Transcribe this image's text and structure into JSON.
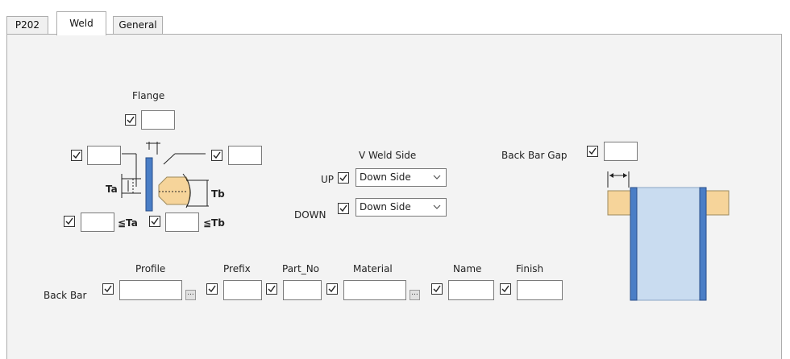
{
  "tabs": [
    "P202",
    "Weld",
    "General"
  ],
  "active_tab": "Weld",
  "flange": {
    "label": "Flange"
  },
  "diagram": {
    "ta": "Ta",
    "tb": "Tb",
    "le_ta": "≦Ta",
    "le_tb": "≦Tb"
  },
  "v_weld": {
    "title": "V Weld Side",
    "up_label": "UP",
    "down_label": "DOWN",
    "up_value": "Down Side",
    "down_value": "Down Side"
  },
  "back_bar_gap": {
    "label": "Back Bar Gap"
  },
  "back_bar": {
    "row_label": "Back Bar",
    "headers": {
      "profile": "Profile",
      "prefix": "Prefix",
      "part_no": "Part_No",
      "material": "Material",
      "name": "Name",
      "finish": "Finish"
    },
    "browse_button": "..."
  },
  "icons": {
    "checkbox_check": "check-icon",
    "dropdown": "chevron-down-icon"
  },
  "colors": {
    "plate_blue": "#4a7ec6",
    "bar_fill": "#c9dcf0",
    "weld_fill": "#f6d49a",
    "weld_stroke": "#9c8a5c"
  }
}
